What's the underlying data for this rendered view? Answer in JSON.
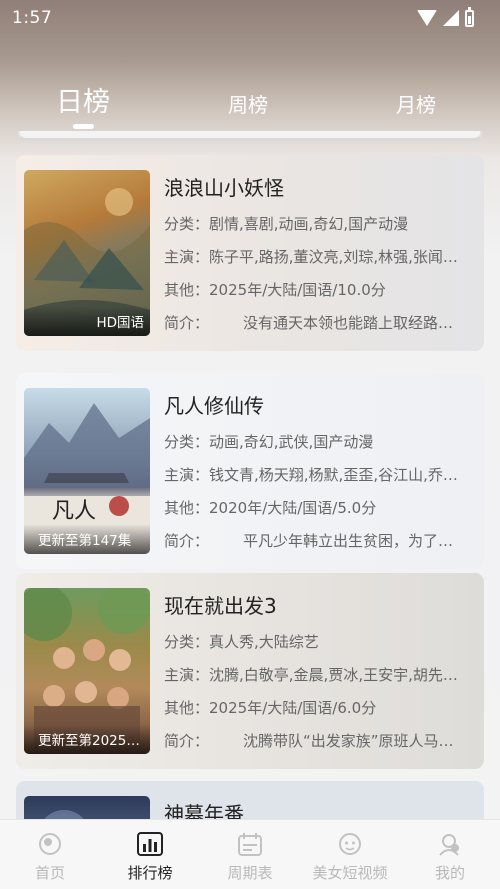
{
  "status_bar": {
    "time": "1:57"
  },
  "tabs": [
    {
      "label": "日榜",
      "active": true
    },
    {
      "label": "周榜",
      "active": false
    },
    {
      "label": "月榜",
      "active": false
    }
  ],
  "items": [
    {
      "title": "浪浪山小妖怪",
      "badge": "HD国语",
      "category_key": "分类：",
      "category": "剧情,喜剧,动画,奇幻,国产动漫",
      "cast_key": "主演：",
      "cast": "陈子平,路扬,董汶亮,刘琮,林强,张闻…",
      "other_key": "其他：",
      "other": "2025年/大陆/国语/10.0分",
      "intro_key": "简介：",
      "intro": "没有通天本领也能踏上取经路…"
    },
    {
      "title": "凡人修仙传",
      "badge": "更新至第147集",
      "category_key": "分类：",
      "category": "动画,奇幻,武侠,国产动漫",
      "cast_key": "主演：",
      "cast": "钱文青,杨天翔,杨默,歪歪,谷江山,乔…",
      "other_key": "其他：",
      "other": "2020年/大陆/国语/5.0分",
      "intro_key": "简介：",
      "intro": "平凡少年韩立出生贫困，为了…"
    },
    {
      "title": "现在就出发3",
      "badge": "更新至第2025…",
      "category_key": "分类：",
      "category": "真人秀,大陆综艺",
      "cast_key": "主演：",
      "cast": "沈腾,白敬亭,金晨,贾冰,王安宇,胡先…",
      "other_key": "其他：",
      "other": "2025年/大陆/国语/6.0分",
      "intro_key": "简介：",
      "intro": "沈腾带队“出发家族”原班人马…"
    },
    {
      "title": "神墓年番"
    }
  ],
  "bottom_nav": [
    {
      "label": "首页",
      "icon": "home-icon",
      "active": false
    },
    {
      "label": "排行榜",
      "icon": "ranking-icon",
      "active": true
    },
    {
      "label": "周期表",
      "icon": "calendar-icon",
      "active": false
    },
    {
      "label": "美女短视频",
      "icon": "short-video-icon",
      "active": false
    },
    {
      "label": "我的",
      "icon": "profile-icon",
      "active": false
    }
  ]
}
